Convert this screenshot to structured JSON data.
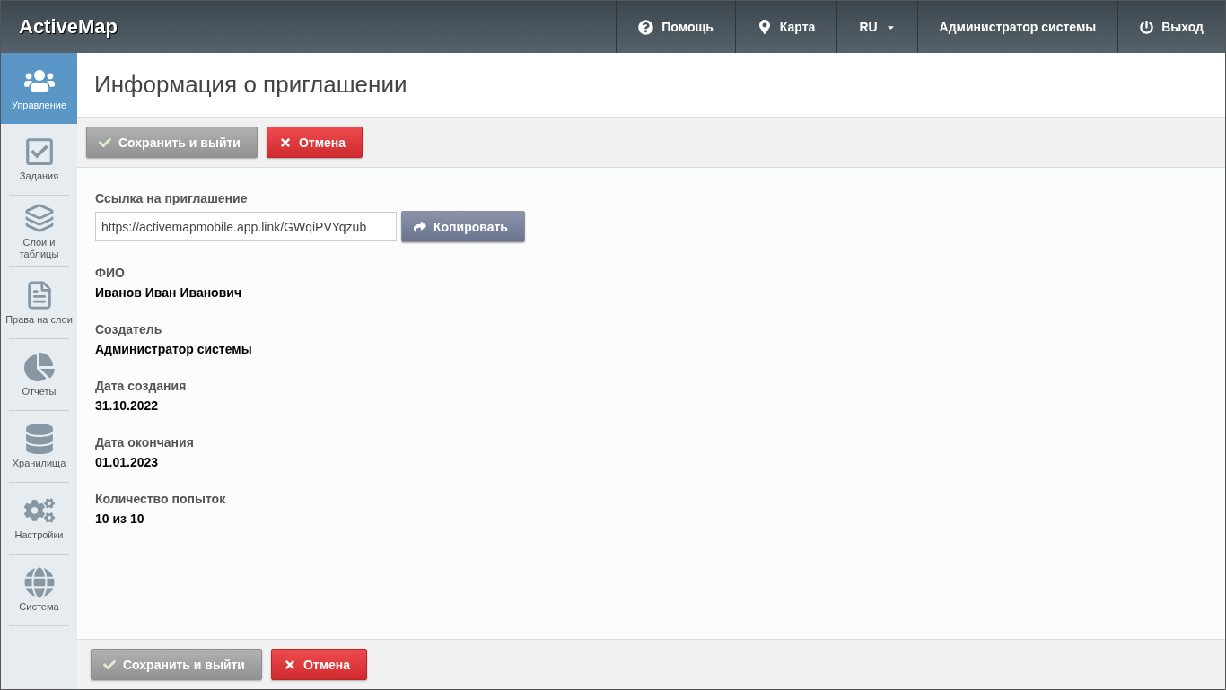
{
  "header": {
    "brand": "ActiveMap",
    "nav": [
      {
        "label": "Помощь",
        "kind": "help"
      },
      {
        "label": "Карта",
        "kind": "map"
      },
      {
        "label": "RU",
        "kind": "dropdown"
      },
      {
        "label": "Администратор системы",
        "kind": "plain"
      },
      {
        "label": "Выход",
        "kind": "logout"
      }
    ]
  },
  "sidebar": {
    "items": [
      {
        "label": "Управление",
        "selected": true
      },
      {
        "label": "Задания",
        "selected": false
      },
      {
        "label": "Слои и таблицы",
        "selected": false
      },
      {
        "label": "Права на слои",
        "selected": false
      },
      {
        "label": "Отчеты",
        "selected": false
      },
      {
        "label": "Хранилища",
        "selected": false
      },
      {
        "label": "Настройки",
        "selected": false
      },
      {
        "label": "Система",
        "selected": false
      }
    ]
  },
  "page": {
    "title": "Информация о приглашении"
  },
  "top_toolbar": {
    "save": "Сохранить и выйти",
    "cancel": "Отмена"
  },
  "form": {
    "link": {
      "label": "Ссылка на приглашение",
      "value": "https://activemapmobile.app.link/GWqiPVYqzub",
      "copy": "Копировать"
    },
    "fields": [
      {
        "label": "ФИО",
        "value": "Иванов Иван Иванович"
      },
      {
        "label": "Создатель",
        "value": "Администратор системы"
      },
      {
        "label": "Дата создания",
        "value": "31.10.2022"
      },
      {
        "label": "Дата окончания",
        "value": "01.01.2023"
      },
      {
        "label": "Количество попыток",
        "value": "10 из 10"
      }
    ]
  },
  "bottom_toolbar": {
    "save": "Сохранить и выйти",
    "cancel": "Отмена"
  }
}
